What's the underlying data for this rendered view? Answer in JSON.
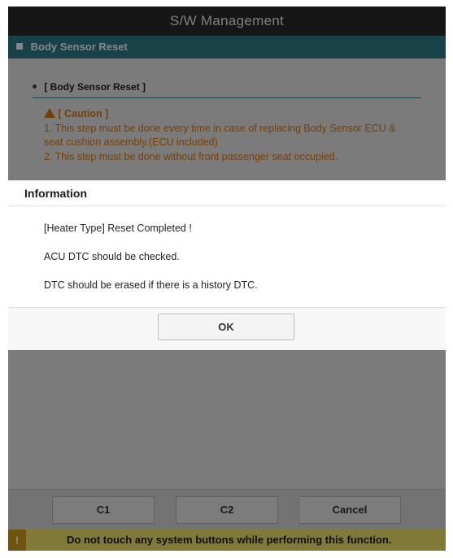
{
  "titlebar": {
    "title": "S/W Management"
  },
  "subbar": {
    "title": "Body Sensor Reset"
  },
  "section": {
    "heading": "[ Body Sensor Reset ]",
    "caution_title": "[ Caution ]",
    "caution_line1": "1. This step must be done every time in case of replacing Body Sensor ECU &",
    "caution_line2": "seat cushion assembly.(ECU included)",
    "caution_line3": "2. This step must be done without front passenger seat occupied."
  },
  "dialog": {
    "title": "Information",
    "line1": "[Heater Type] Reset Completed !",
    "line2": "ACU DTC should be checked.",
    "line3": "DTC should be erased if there is a history DTC.",
    "ok_label": "OK"
  },
  "footer": {
    "c1_label": "C1",
    "c2_label": "C2",
    "cancel_label": "Cancel"
  },
  "warning_bar": {
    "icon_glyph": "!",
    "message": "Do not touch any system buttons while performing this function."
  },
  "colors": {
    "titlebar_bg": "#2b2b2b",
    "subbar_bg": "#2f7d8b",
    "caution_text": "#e07a10",
    "warning_bar_bg": "#f5e86a"
  },
  "icons": [
    "square-bullet-icon",
    "dot-bullet-icon",
    "warning-triangle-icon",
    "exclamation-icon"
  ]
}
